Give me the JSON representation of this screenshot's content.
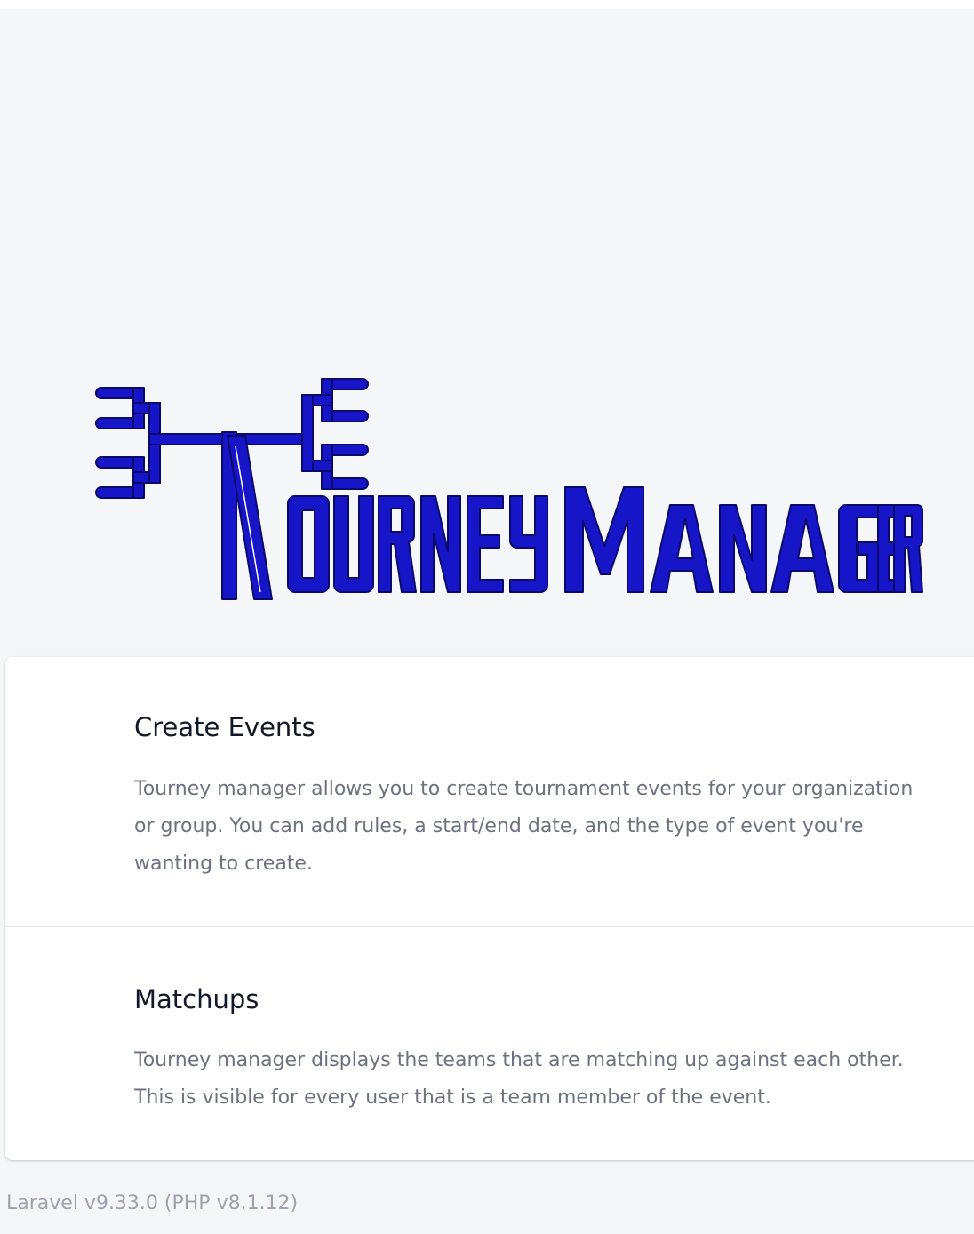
{
  "logo": {
    "name": "Tourney Manager",
    "color": "#1616c8"
  },
  "features": [
    {
      "title": "Create Events",
      "description": "Tourney manager allows you to create tournament events for your organization or group. You can add rules, a start/end date, and the type of event you're wanting to create."
    },
    {
      "title": "Matchups",
      "description": "Tourney manager displays the teams that are matching up against each other. This is visible for every user that is a team member of the event."
    }
  ],
  "footer": {
    "version": "Laravel v9.33.0 (PHP v8.1.12)"
  }
}
